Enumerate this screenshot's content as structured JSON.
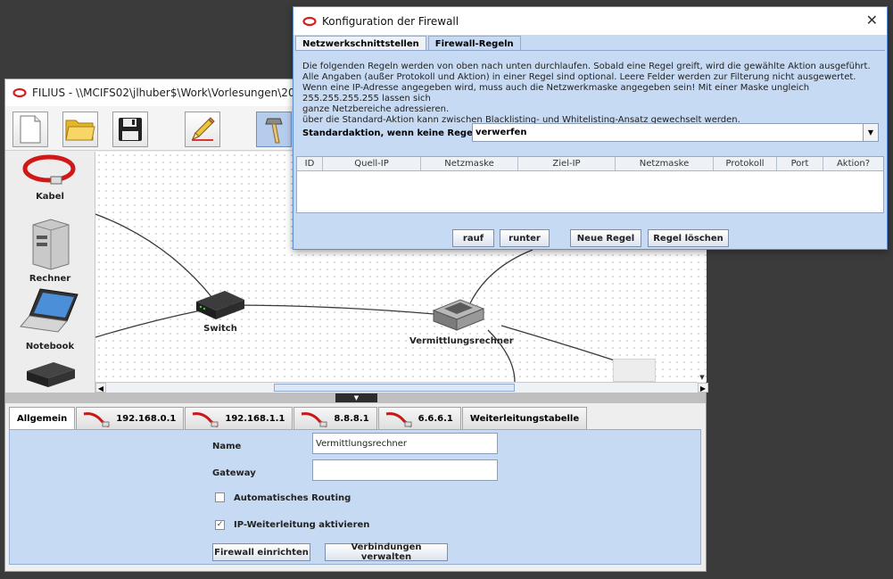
{
  "main_window": {
    "title": "FILIUS - \\\\MCIFS02\\jlhuber$\\Work\\Vorlesungen\\2022_W"
  },
  "toolbar": {
    "buttons": [
      {
        "icon": "new-file-icon"
      },
      {
        "icon": "open-folder-icon"
      },
      {
        "icon": "save-icon"
      },
      {
        "icon": "design-mode-pencil-icon"
      },
      {
        "icon": "simulation-mode-hammer-icon",
        "active": true
      }
    ]
  },
  "palette": {
    "items": [
      {
        "label": "Kabel",
        "icon": "cable-icon"
      },
      {
        "label": "Rechner",
        "icon": "computer-icon"
      },
      {
        "label": "Notebook",
        "icon": "notebook-icon"
      },
      {
        "label": "",
        "icon": "switch-icon"
      }
    ]
  },
  "canvas": {
    "nodes": [
      {
        "label": "Switch",
        "icon": "switch-icon"
      },
      {
        "label": "Vermittlungsrechner",
        "icon": "router-icon"
      }
    ]
  },
  "config": {
    "tabs": [
      {
        "label": "Allgemein",
        "active": true
      },
      {
        "label": "192.168.0.1",
        "icon": "cable-icon"
      },
      {
        "label": "192.168.1.1",
        "icon": "cable-icon"
      },
      {
        "label": "8.8.8.1",
        "icon": "cable-icon"
      },
      {
        "label": "6.6.6.1",
        "icon": "cable-icon"
      },
      {
        "label": "Weiterleitungstabelle"
      }
    ],
    "name_label": "Name",
    "name_value": "Vermittlungsrechner",
    "gateway_label": "Gateway",
    "gateway_value": "",
    "auto_routing_label": "Automatisches Routing",
    "auto_routing_checked": false,
    "ip_forwarding_label": "IP-Weiterleitung aktivieren",
    "ip_forwarding_checked": true,
    "firewall_button": "Firewall einrichten",
    "connections_button": "Verbindungen verwalten"
  },
  "dialog": {
    "title": "Konfiguration der Firewall",
    "close_symbol": "✕",
    "tabs": [
      {
        "label": "Netzwerkschnittstellen",
        "active": false
      },
      {
        "label": "Firewall-Regeln",
        "active": true
      }
    ],
    "description": [
      "Die folgenden Regeln werden von oben nach unten durchlaufen. Sobald eine Regel greift, wird die gewählte Aktion ausgeführt.",
      "Alle Angaben (außer Protokoll und Aktion) in einer Regel sind optional. Leere Felder werden zur Filterung nicht ausgewertet.",
      "Wenn eine IP-Adresse angegeben wird, muss auch die Netzwerkmaske angegeben sein! Mit einer Maske ungleich 255.255.255.255 lassen sich",
      "ganze Netzbereiche adressieren.",
      "über die Standard-Aktion kann zwischen Blacklisting- und Whitelisting-Ansatz gewechselt werden."
    ],
    "default_action_label": "Standardaktion, wenn keine Regel greift:",
    "default_action_value": "verwerfen",
    "table_columns": [
      "ID",
      "Quell-IP",
      "Netzmaske",
      "Ziel-IP",
      "Netzmaske",
      "Protokoll",
      "Port",
      "Aktion?"
    ],
    "table_rows": [],
    "buttons": {
      "up": "rauf",
      "down": "runter",
      "new_rule": "Neue Regel",
      "delete_rule": "Regel löschen"
    }
  }
}
